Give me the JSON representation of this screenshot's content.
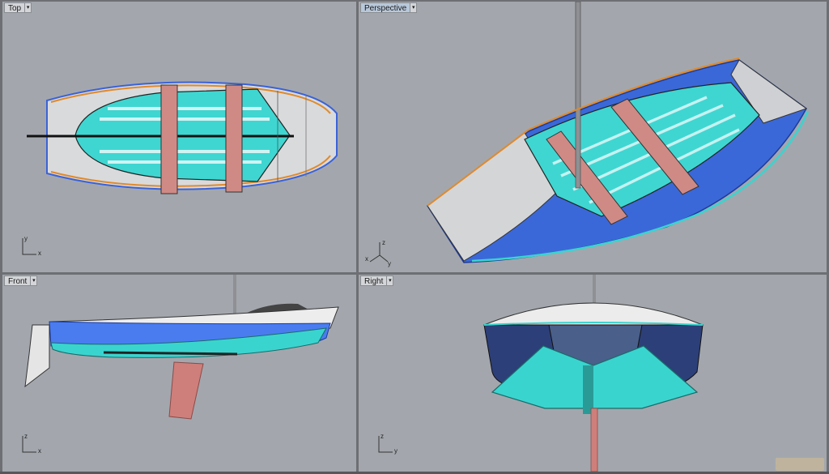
{
  "viewports": {
    "top": {
      "title": "Top",
      "axis_v": "y",
      "axis_h": "x"
    },
    "perspective": {
      "title": "Perspective",
      "axis_a": "z",
      "axis_b": "x",
      "axis_c": "y"
    },
    "front": {
      "title": "Front",
      "axis_v": "z",
      "axis_h": "x"
    },
    "right": {
      "title": "Right",
      "axis_v": "z",
      "axis_h": "y"
    }
  },
  "dropdown_glyph": "▾",
  "watermark": "",
  "colors": {
    "viewport_bg": "#a3a7ad",
    "hull_blue": "#3f6fe0",
    "hull_teal": "#3ad4cf",
    "seat_pink": "#cf8a86",
    "deck_gray": "#d7d8da",
    "outline_orange": "#e08a2b"
  }
}
